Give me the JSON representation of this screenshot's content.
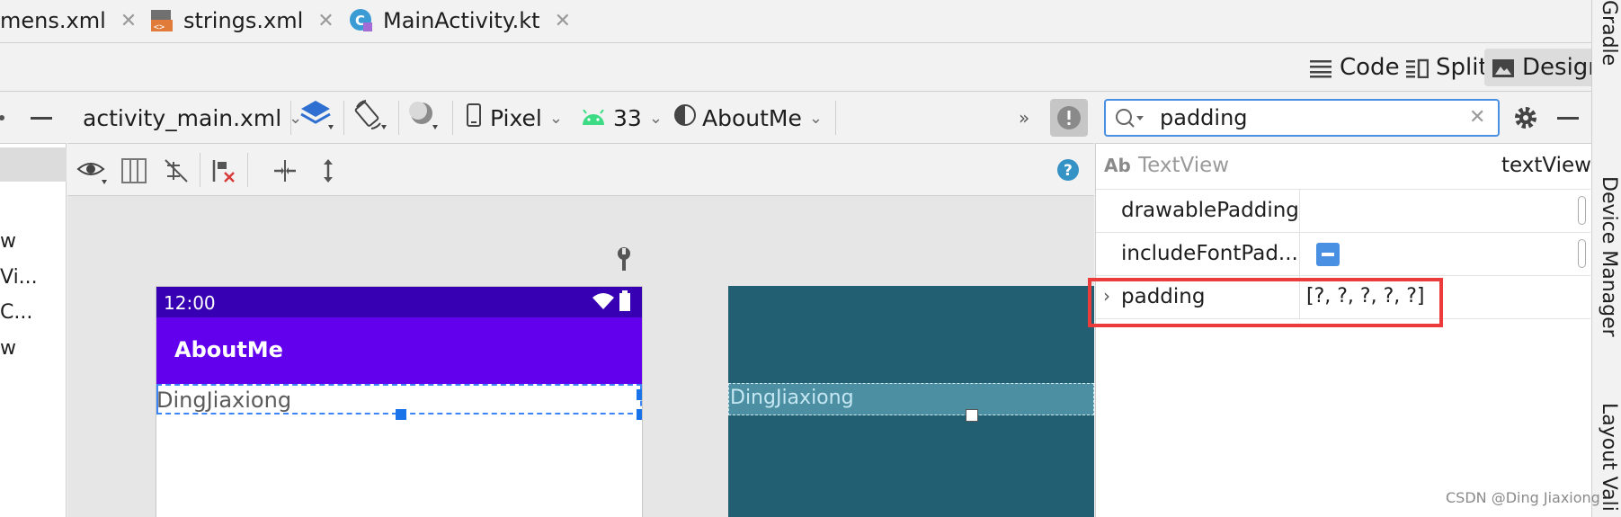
{
  "tabs": [
    {
      "label": "mens.xml",
      "icon": "xml-file-icon"
    },
    {
      "label": "strings.xml",
      "icon": "strings-xml-icon"
    },
    {
      "label": "MainActivity.kt",
      "icon": "kotlin-file-icon"
    }
  ],
  "close_glyph": "✕",
  "view_modes": {
    "code": "Code",
    "split": "Split",
    "design": "Design",
    "active": "Design"
  },
  "palette_items": [
    "w",
    "Vi...",
    "C...",
    "w"
  ],
  "design_toolbar": {
    "file": "activity_main.xml",
    "device": "Pixel",
    "api": "33",
    "theme": "AboutMe",
    "more": "»"
  },
  "phone": {
    "time": "12:00",
    "app_title": "AboutMe",
    "textview_text": "DingJiaxiong"
  },
  "blueprint": {
    "textview_text": "DingJiaxiong"
  },
  "attributes": {
    "search_value": "padding",
    "component_type_badge": "Ab",
    "component_type": "TextView",
    "component_id": "textView",
    "rows": [
      {
        "name": "drawablePadding",
        "value": ""
      },
      {
        "name": "includeFontPad...",
        "value": ""
      },
      {
        "name": "padding",
        "value": "[?, ?, ?, ?, ?]"
      }
    ]
  },
  "side_tools": [
    "Gradle",
    "Device Manager",
    "Layout Vali"
  ],
  "watermark": "CSDN @Ding Jiaxiong",
  "colors": {
    "status_bar": "#3700b3",
    "app_bar": "#6200ee",
    "blueprint": "#235f72",
    "selection": "#3d85f5",
    "highlight": "#ec3b3b"
  }
}
